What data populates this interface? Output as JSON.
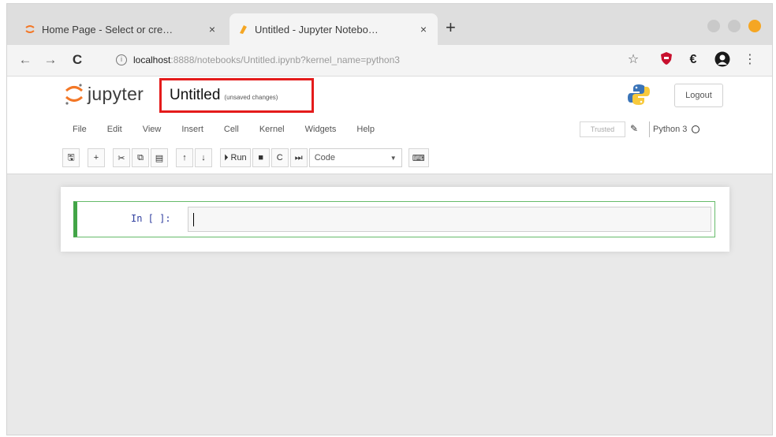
{
  "browser": {
    "tabs": [
      {
        "title": "Home Page - Select or cre…",
        "active": false
      },
      {
        "title": "Untitled - Jupyter Notebo…",
        "active": true
      }
    ],
    "new_tab": "+",
    "close_glyph": "×",
    "address": {
      "host": "localhost",
      "path": ":8888/notebooks/Untitled.ipynb?kernel_name=python3"
    },
    "nav": {
      "back": "←",
      "forward": "→",
      "reload": "C"
    },
    "star": "☆",
    "window_controls_colors": [
      "#c7c7c7",
      "#c7c7c7",
      "#f5a623"
    ]
  },
  "jupyter": {
    "logo_text": "jupyter",
    "notebook_name": "Untitled",
    "unsaved": "(unsaved changes)",
    "logout": "Logout",
    "menu": [
      "File",
      "Edit",
      "View",
      "Insert",
      "Cell",
      "Kernel",
      "Widgets",
      "Help"
    ],
    "trusted": "Trusted",
    "kernel_name": "Python 3",
    "toolbar": {
      "save": "🖫",
      "add": "+",
      "cut": "✂",
      "copy": "⧉",
      "paste": "▤",
      "up": "↑",
      "down": "↓",
      "run": "Run",
      "stop": "■",
      "restart": "C",
      "fast_forward": "⏭",
      "cell_type": "Code",
      "keyboard": "⌨"
    },
    "cell": {
      "prompt": "In [ ]:",
      "source": ""
    },
    "highlight_color": "#e41b1b",
    "cell_border_color": "#42a547"
  }
}
